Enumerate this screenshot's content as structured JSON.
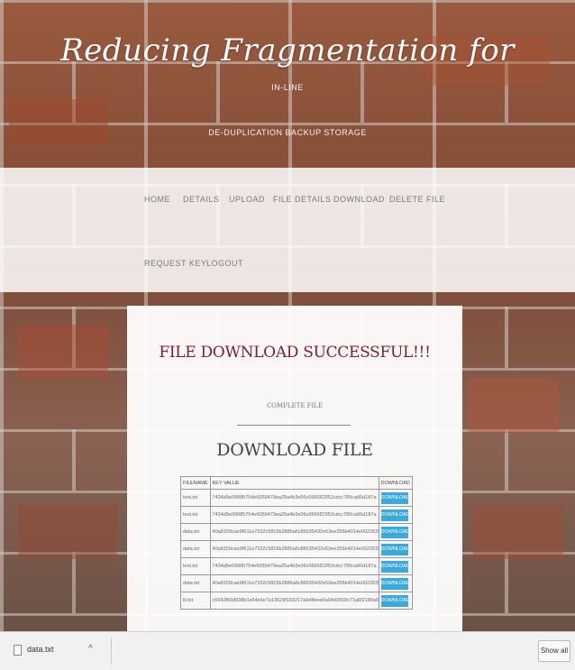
{
  "header": {
    "title": "Reducing Fragmentation for",
    "subtitle_line1": "IN-LINE",
    "subtitle_line2": "DE-DUPLICATION BACKUP STORAGE"
  },
  "nav": {
    "items": [
      {
        "label": "HOME"
      },
      {
        "label": "DETAILS"
      },
      {
        "label": "UPLOAD"
      },
      {
        "label": "FILE DETAILS"
      },
      {
        "label": "DOWNLOAD"
      },
      {
        "label": "DELETE FILE"
      },
      {
        "label": "REQUEST KEY"
      },
      {
        "label": "LOGOUT"
      }
    ]
  },
  "main": {
    "success_message": "FILE DOWNLOAD SUCCESSFUL!!!",
    "complete_label": "COMPLETE FILE",
    "section_title": "DOWNLOAD FILE",
    "table": {
      "headers": [
        "FILENAME",
        "KEY VALUE",
        "DOWNLOAD"
      ],
      "rows": [
        {
          "filename": "text.txt",
          "key": "7434d9e09085754e6059479ea25a4b3e06c0666f22f52cdcc785ca66d187a",
          "action": "DOWNLOAD"
        },
        {
          "filename": "text.txt",
          "key": "7434d9e09085754e6059479ea25a4b3e06c0666f22f52cdcc785ca66d187a",
          "action": "DOWNLOAD"
        },
        {
          "filename": "data.txt",
          "key": "40a8159cae9f611e7332c5815b2886a6c86635432e53ee255b4014e00226355",
          "action": "DOWNLOAD"
        },
        {
          "filename": "data.txt",
          "key": "40a8159cae9f611e7332c5815b2886a6c86635432e53ee255b4014e00226355",
          "action": "DOWNLOAD"
        },
        {
          "filename": "text.txt",
          "key": "7434d9e09085754e6059479ea25a4b3e06c0666f22f52cdcc785ca66d187a",
          "action": "DOWNLOAD"
        },
        {
          "filename": "data.txt",
          "key": "40a8159cae9f611e7332c5815b2886a6c86635432e53ee255b4014e00226355",
          "action": "DOWNLOAD"
        },
        {
          "filename": "lit.txt",
          "key": "c6642f66d938b1e64e6e7a13629f183217a6d8eee6a94d2650c71a6f2189a67a",
          "action": "DOWNLOAD"
        }
      ]
    }
  },
  "download_bar": {
    "file_name": "data.txt",
    "chevron": "^",
    "show_all_label": "Show all"
  },
  "colors": {
    "success_text": "#7a1e2c",
    "download_button": "#3aa9dc"
  }
}
